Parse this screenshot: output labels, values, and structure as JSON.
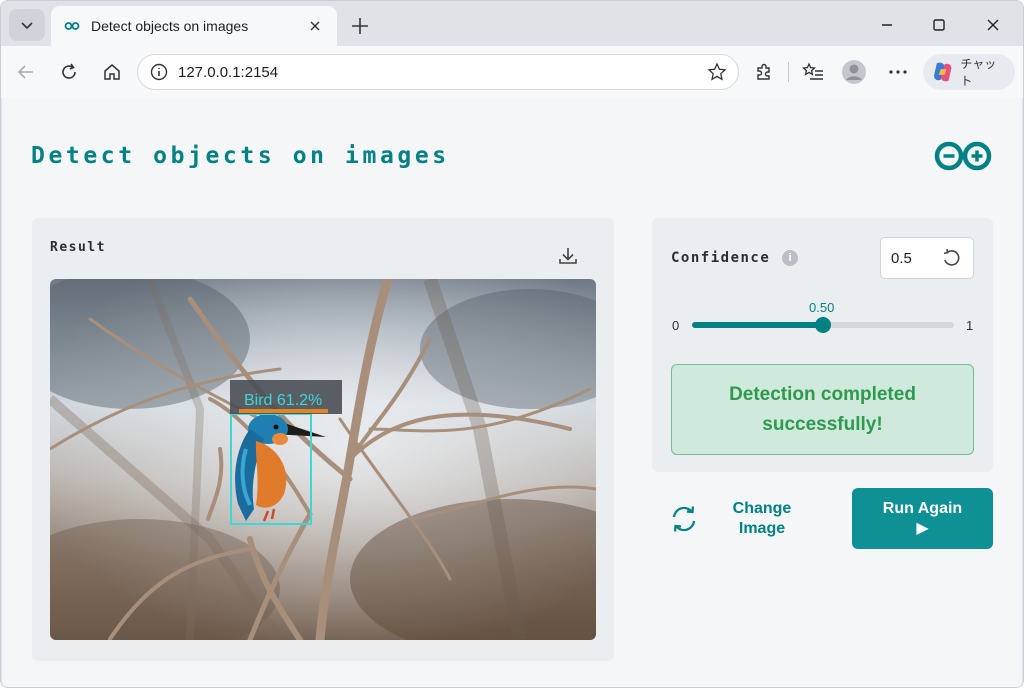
{
  "browser": {
    "tab_title": "Detect objects on images",
    "url": "127.0.0.1:2154",
    "copilot_label": "チャット",
    "icons": {
      "tab_list": "chevron-down-icon",
      "favicon": "infinity-icon",
      "tab_close": "close-icon",
      "new_tab": "plus-icon",
      "minimize": "minimize-icon",
      "maximize": "maximize-icon",
      "close_window": "close-icon",
      "back": "back-arrow-icon",
      "reload": "reload-icon",
      "home": "home-icon",
      "site_info": "info-icon",
      "favorite": "star-icon",
      "extensions": "puzzle-icon",
      "favorites": "favorites-list-icon",
      "profile": "avatar-icon",
      "more": "more-icon"
    }
  },
  "app": {
    "title": "Detect objects on images",
    "brand_color": "#008184"
  },
  "result": {
    "label": "Result",
    "detection": {
      "label": "Bird 61.2%",
      "class": "Bird",
      "score_percent": 61.2,
      "box_color": "#3ed6d6"
    }
  },
  "controls": {
    "confidence_label": "Confidence",
    "info_glyph": "i",
    "confidence_value": "0.5",
    "slider": {
      "min_label": "0",
      "max_label": "1",
      "value_label": "0.50",
      "value": 0.5
    },
    "status_message": "Detection completed successfully!",
    "status_color": "#2e9a4e",
    "change_image_label": "Change Image",
    "run_again_label": "Run Again",
    "run_again_icon": "▶"
  }
}
